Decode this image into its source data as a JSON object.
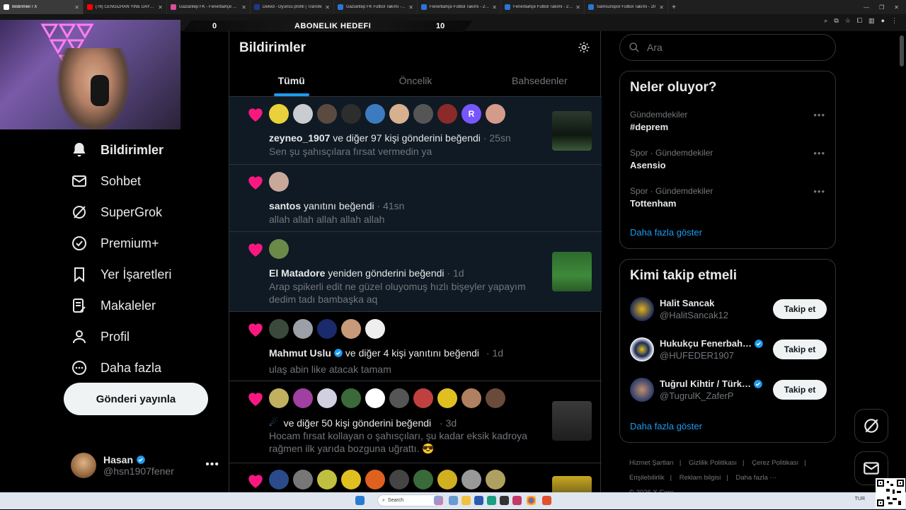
{
  "browser": {
    "tabs": [
      {
        "title": "Bildirimler / X",
        "icon_color": "#ffffff",
        "active": true
      },
      {
        "title": "(76) CENGIZHAN YINE DAYAK",
        "icon_color": "#ff0000"
      },
      {
        "title": "Gaziantep FK - Fenerbahçe Maç",
        "icon_color": "#d94f9a"
      },
      {
        "title": "Delvid - Oyuncu profili | Transfe",
        "icon_color": "#1a3a8a"
      },
      {
        "title": "Gaziantep FK Futbol Takımı - 20",
        "icon_color": "#2a76d2"
      },
      {
        "title": "Fenerbahçe Futbol Takımı - 202",
        "icon_color": "#2a76d2"
      },
      {
        "title": "Fenerbahçe Futbol Takımı - 202",
        "icon_color": "#2a76d2"
      },
      {
        "title": "Samsunspor Futbol Takımı - 20",
        "icon_color": "#2a76d2"
      }
    ],
    "new_tab": "+"
  },
  "stream_overlay": {
    "left_value": "0",
    "center_label": "ABONELIK HEDEFI",
    "right_value": "10"
  },
  "nav": {
    "items": [
      {
        "label": "Bildirimler",
        "icon": "bell-icon"
      },
      {
        "label": "Sohbet",
        "icon": "mail-icon"
      },
      {
        "label": "SuperGrok",
        "icon": "grok-icon"
      },
      {
        "label": "Premium+",
        "icon": "verified-icon"
      },
      {
        "label": "Yer İşaretleri",
        "icon": "bookmark-icon"
      },
      {
        "label": "Makaleler",
        "icon": "article-icon"
      },
      {
        "label": "Profil",
        "icon": "profile-icon"
      },
      {
        "label": "Daha fazla",
        "icon": "more-circle-icon"
      }
    ],
    "post_button": "Gönderi yayınla"
  },
  "account": {
    "name": "Hasan",
    "handle": "@hsn1907fener",
    "more": "•••"
  },
  "main": {
    "title": "Bildirimler",
    "tabs": [
      "Tümü",
      "Öncelik",
      "Bahsedenler"
    ],
    "notifications": [
      {
        "user": "zeyneo_1907",
        "action": " ve diğer 97 kişi gönderini beğendi",
        "time": "· 25sn",
        "text": "Sen şu şahısçılara fırsat vermedin ya",
        "avatar_letter": "R"
      },
      {
        "user": "santos",
        "action": " yanıtını beğendi",
        "time": "· 41sn",
        "text": "allah allah allah allah allah"
      },
      {
        "user": "El Matadore",
        "action": " yeniden gönderini beğendi",
        "time": "· 1d",
        "text": "Arap spikerli edit ne güzel oluyomuş hızlı bişeyler yapayım dedim tadı bambaşka aq"
      },
      {
        "user": "Mahmut Uslu",
        "action": " ve diğer 4 kişi yanıtını beğendi",
        "time": "· 1d",
        "text": "ulaş abin like atacak tamam"
      },
      {
        "user": "",
        "action": "ve diğer 50 kişi gönderini beğendi",
        "time": "· 3d",
        "text": "Hocam fırsat kollayan o şahısçıları, şu kadar eksik kadroya rağmen ilk yarıda bozguna uğrattı. 😎"
      }
    ]
  },
  "sidebar_right": {
    "search_placeholder": "Ara",
    "trends_title": "Neler oluyor?",
    "trends": [
      {
        "context": "Gündemdekiler",
        "name": "#deprem"
      },
      {
        "context": "Spor · Gündemdekiler",
        "name": "Asensio"
      },
      {
        "context": "Spor · Gündemdekiler",
        "name": "Tottenham"
      }
    ],
    "trend_more": "•••",
    "trends_show_more": "Daha fazla göster",
    "follow_title": "Kimi takip etmeli",
    "follow_suggestions": [
      {
        "name": "Halit Sancak",
        "handle": "@HalitSancak12",
        "button": "Takip et"
      },
      {
        "name": "Hukukçu Fenerbah…",
        "handle": "@HUFEDER1907",
        "button": "Takip et"
      },
      {
        "name": "Tuğrul Kihtir / Türk…",
        "handle": "@TugrulK_ZaferP",
        "button": "Takip et"
      }
    ],
    "follow_show_more": "Daha fazla göster",
    "footer": [
      "Hizmet Şartları",
      "|",
      "Gizlilik Politikası",
      "|",
      "Çerez Politikası",
      "|",
      "Erişilebilirlik",
      "|",
      "Reklam bilgisi",
      "|",
      "Daha fazla ···",
      "© 2026 X Corp."
    ]
  },
  "taskbar": {
    "search_placeholder": "Search",
    "tray": "TUR"
  },
  "colors": {
    "accent": "#1d9bf0",
    "heart": "#f91880",
    "background": "#000000"
  }
}
